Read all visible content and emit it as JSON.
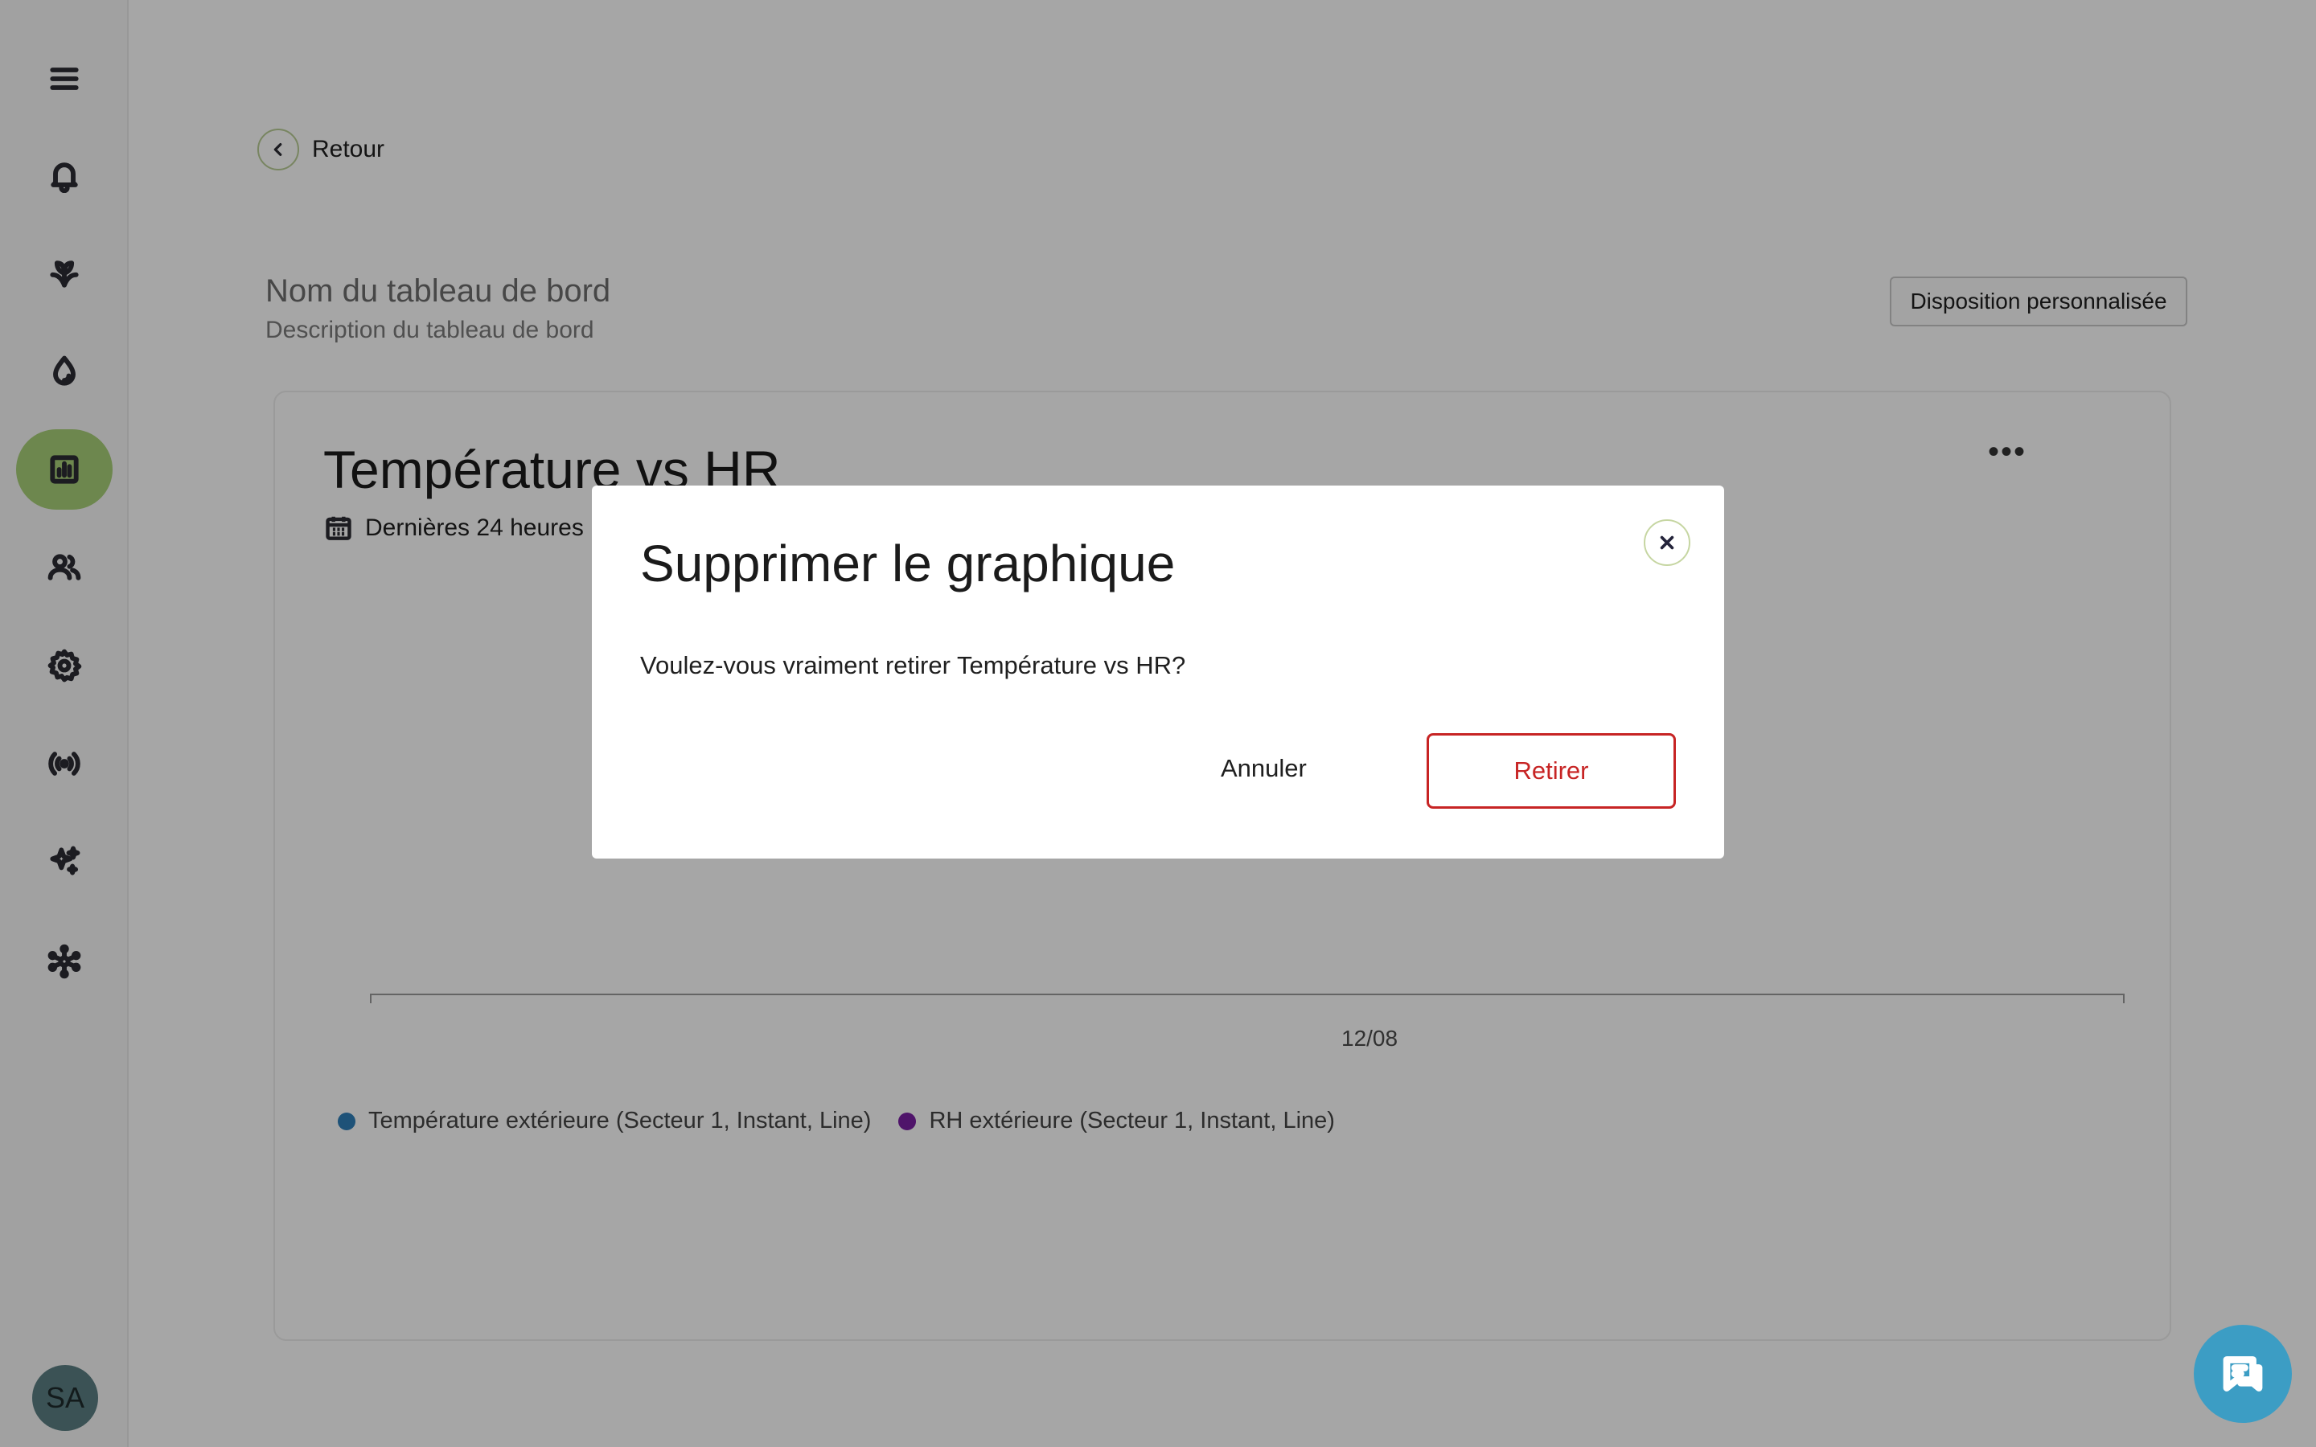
{
  "sidebar": {
    "items": [
      {
        "icon": "menu-icon"
      },
      {
        "icon": "bell-icon"
      },
      {
        "icon": "plant-icon"
      },
      {
        "icon": "water-drop-icon"
      },
      {
        "icon": "chart-icon",
        "active": true
      },
      {
        "icon": "users-icon"
      },
      {
        "icon": "gear-icon"
      },
      {
        "icon": "signal-icon"
      },
      {
        "icon": "sparkles-icon"
      },
      {
        "icon": "network-icon"
      }
    ],
    "avatar_initials": "SA"
  },
  "header": {
    "back_label": "Retour",
    "dashboard_name": "Nom du tableau de bord",
    "dashboard_description": "Description du tableau de bord",
    "layout_button": "Disposition personnalisée"
  },
  "chart_card": {
    "title": "Température vs HR",
    "range_label": "Dernières 24 heures",
    "more_icon": "more-horizontal-icon"
  },
  "chart_data": {
    "type": "line",
    "title": "Température vs HR",
    "x_tick_labels": [
      "12/08"
    ],
    "series": [
      {
        "name": "Température extérieure (Secteur 1, Instant, Line)",
        "color": "#2f7fb8",
        "values": []
      },
      {
        "name": "RH extérieure (Secteur 1, Instant, Line)",
        "color": "#7a1fa3",
        "values": []
      }
    ]
  },
  "modal": {
    "title": "Supprimer le graphique",
    "message": "Voulez-vous vraiment retirer Température vs HR?",
    "cancel_label": "Annuler",
    "confirm_label": "Retirer"
  },
  "colors": {
    "active_nav": "#a8cf78",
    "danger": "#c72424",
    "chat_fab": "#3c9dc4"
  }
}
